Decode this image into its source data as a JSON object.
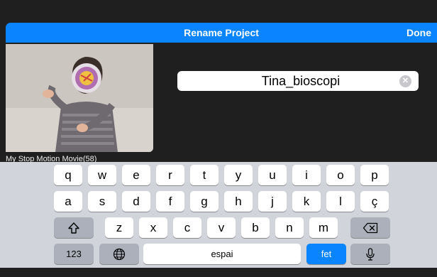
{
  "navbar": {
    "title": "Rename Project",
    "done_label": "Done"
  },
  "project": {
    "name_value": "Tina_bioscopi",
    "thumbnail_caption": "My Stop Motion Movie(58)"
  },
  "keyboard": {
    "row1": [
      "q",
      "w",
      "e",
      "r",
      "t",
      "y",
      "u",
      "i",
      "o",
      "p"
    ],
    "row2": [
      "a",
      "s",
      "d",
      "f",
      "g",
      "h",
      "j",
      "k",
      "l",
      "ç"
    ],
    "row3": [
      "z",
      "x",
      "c",
      "v",
      "b",
      "n",
      "m"
    ],
    "numbers_label": "123",
    "space_label": "espai",
    "return_label": "fet",
    "icons": {
      "shift": "shift-icon",
      "delete": "delete-icon",
      "globe": "globe-icon",
      "mic": "microphone-icon"
    }
  },
  "colors": {
    "accent": "#0a84ff",
    "background": "#1f1f1f",
    "keyboard": "#d1d4db"
  }
}
